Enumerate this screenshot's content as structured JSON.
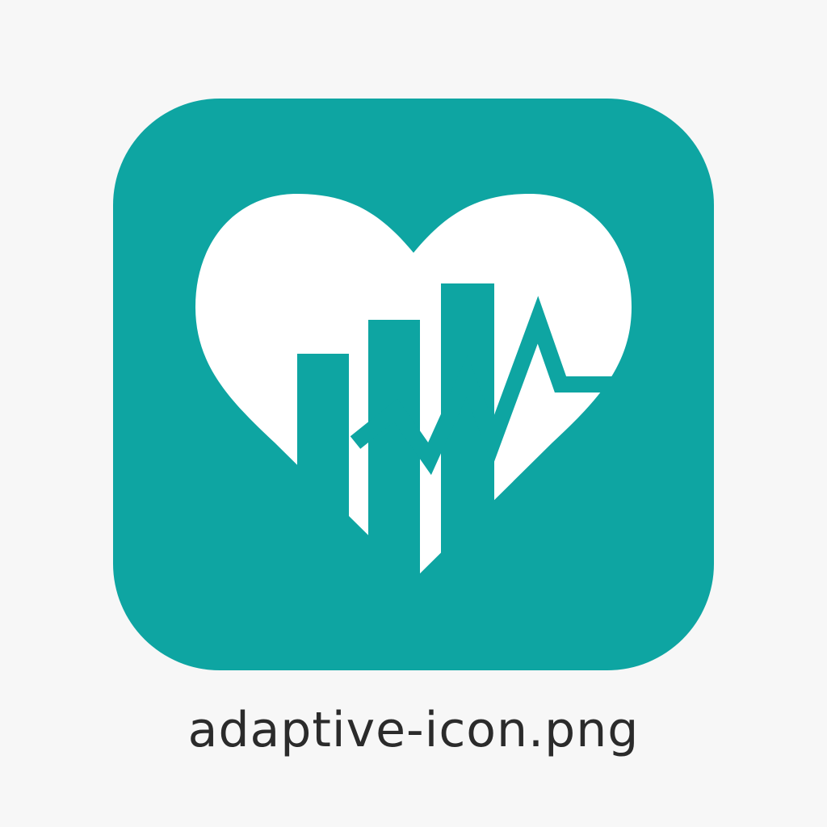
{
  "icon": {
    "name": "heart-chart-pulse-icon",
    "colors": {
      "tile": "#0ea5a2",
      "heart": "#ffffff",
      "background": "#f7f7f7"
    }
  },
  "file_label": "adaptive-icon.png"
}
